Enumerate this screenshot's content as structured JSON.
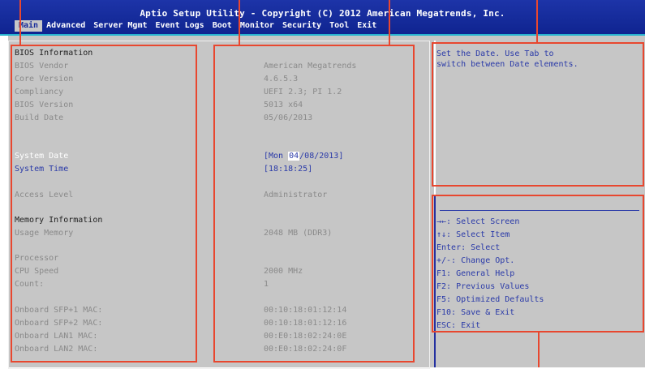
{
  "title": "Aptio Setup Utility - Copyright (C) 2012 American Megatrends, Inc.",
  "tabs": [
    {
      "label": "Main"
    },
    {
      "label": "Advanced"
    },
    {
      "label": "Server Mgmt"
    },
    {
      "label": "Event Logs"
    },
    {
      "label": "Boot"
    },
    {
      "label": "Monitor"
    },
    {
      "label": "Security"
    },
    {
      "label": "Tool"
    },
    {
      "label": "Exit"
    }
  ],
  "bios": {
    "section_title": "BIOS Information",
    "vendor_label": "BIOS Vendor",
    "vendor": "American Megatrends",
    "core_label": "Core Version",
    "core": "4.6.5.3",
    "compliancy_label": "Compliancy",
    "compliancy": "UEFI 2.3; PI 1.2",
    "version_label": "BIOS Version",
    "version": "5013 x64",
    "build_label": "Build Date",
    "build": "05/06/2013"
  },
  "system": {
    "date_label": "System Date",
    "date_pre": "[Mon ",
    "date_hl": "04",
    "date_post": "/08/2013]",
    "time_label": "System Time",
    "time": "[18:18:25]",
    "access_label": "Access Level",
    "access": "Administrator"
  },
  "memory": {
    "section_title": "Memory Information",
    "usage_label": "Usage Memory",
    "usage": "2048 MB (DDR3)"
  },
  "processor": {
    "label": "Processor",
    "speed_label": "CPU Speed",
    "speed": "2000 MHz",
    "count_label": "Count:",
    "count": "1"
  },
  "network": [
    {
      "label": "Onboard SFP+1 MAC:",
      "value": "00:10:18:01:12:14"
    },
    {
      "label": "Onboard SFP+2 MAC:",
      "value": "00:10:18:01:12:16"
    },
    {
      "label": "Onboard LAN1 MAC:",
      "value": "00:E0:18:02:24:0E"
    },
    {
      "label": "Onboard LAN2 MAC:",
      "value": "00:E0:18:02:24:0F"
    }
  ],
  "help": {
    "text": "Set the Date. Use Tab to\nswitch between Date elements.",
    "keys": [
      "→←: Select Screen",
      "↑↓: Select Item",
      "Enter: Select",
      "+/-: Change Opt.",
      "F1: General Help",
      "F2: Previous Values",
      "F5: Optimized Defaults",
      "F10: Save & Exit",
      "ESC: Exit"
    ]
  },
  "colors": {
    "header": "#1d34a8",
    "panel": "#c6c6c6",
    "link": "#2a3aa8",
    "annotation": "#e8472f"
  }
}
